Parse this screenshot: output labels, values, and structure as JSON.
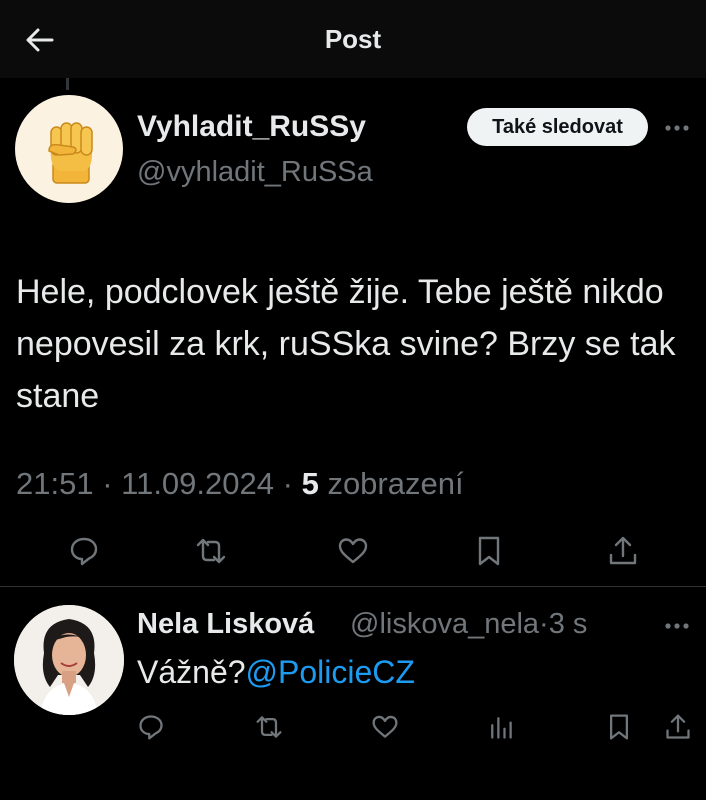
{
  "header": {
    "title": "Post",
    "back_icon": "arrow-left-icon"
  },
  "post": {
    "author": {
      "display_name": "Vyhladit_RuSSy",
      "handle": "@vyhladit_RuSSa",
      "avatar_icon": "raised-fist-emoji"
    },
    "follow_label": "Také sledovat",
    "text": "Hele, podclovek ještě žije. Tebe ještě nikdo nepovesil za krk, ruSSka svine? Brzy se tak stane",
    "time": "21:51",
    "date": "11.09.2024",
    "views_count": "5",
    "views_label": "zobrazení",
    "actions": [
      "reply-icon",
      "repost-icon",
      "like-icon",
      "bookmark-icon",
      "share-icon"
    ]
  },
  "reply": {
    "display_name": "Nela Lisková",
    "handle": "@liskova_nela",
    "time": "3 s",
    "text": "Vážně?",
    "mention": "@PolicieCZ",
    "actions": [
      "reply-icon",
      "repost-icon",
      "like-icon",
      "views-icon",
      "bookmark-icon",
      "share-icon"
    ]
  },
  "colors": {
    "background": "#000000",
    "text": "#e7e9ea",
    "secondary_text": "#71767b",
    "link": "#1d9bf0",
    "button_bg": "#eff3f4"
  }
}
